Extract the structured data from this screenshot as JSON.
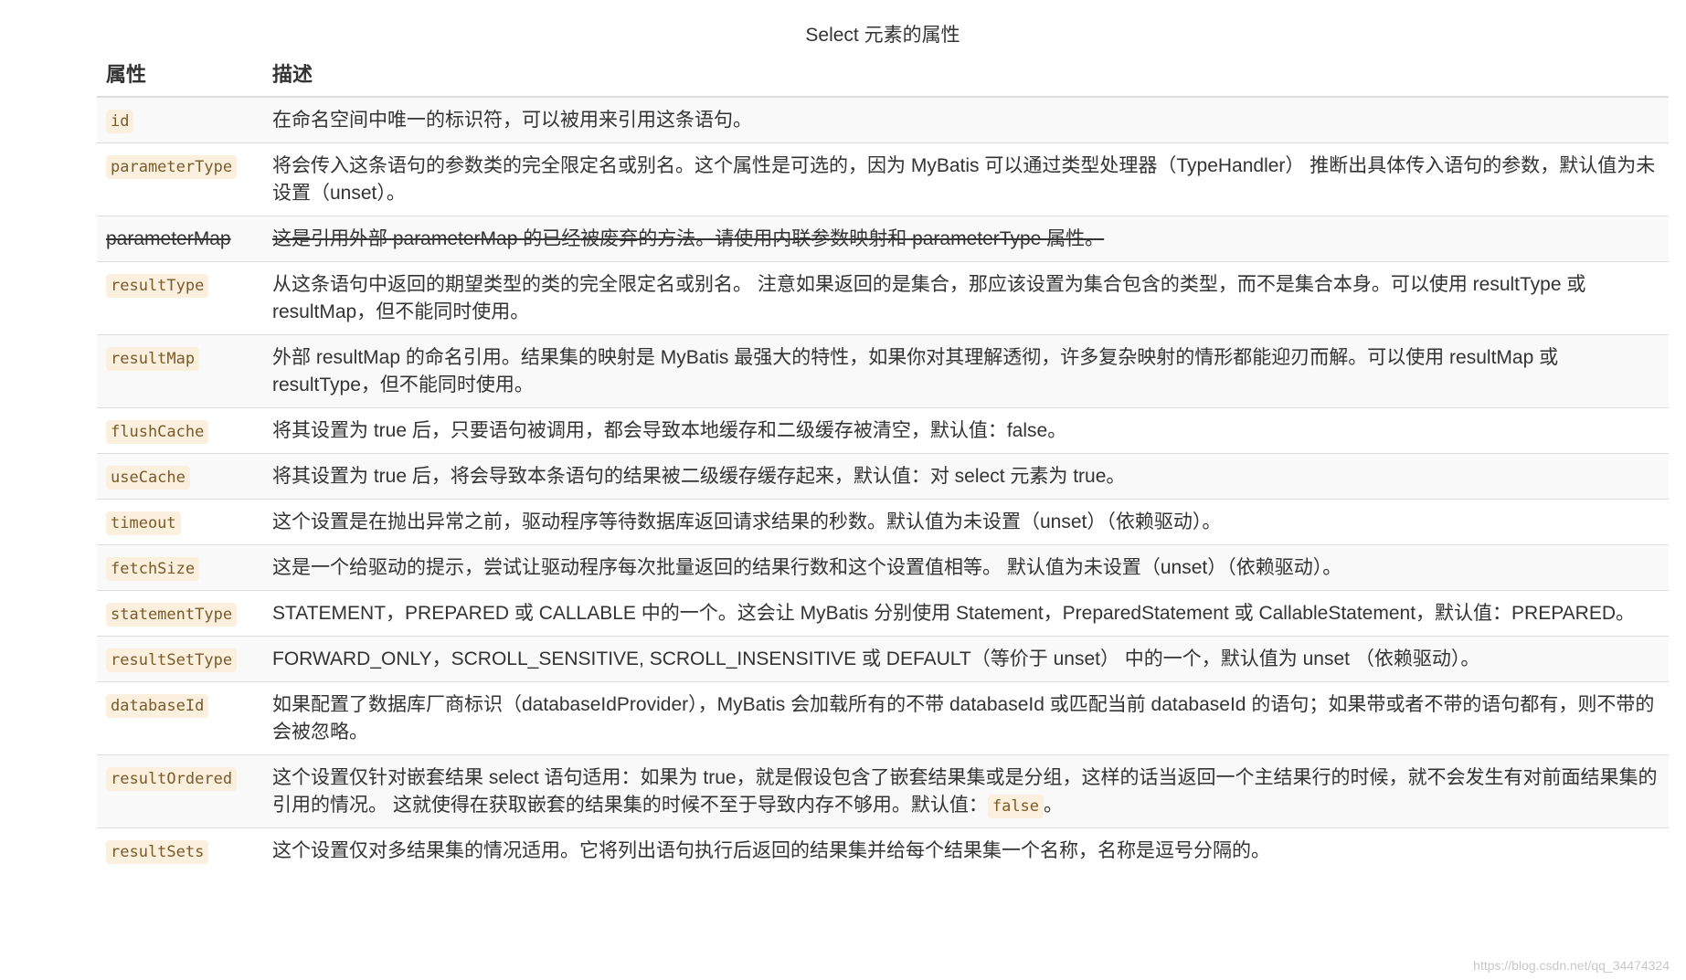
{
  "caption": "Select 元素的属性",
  "table": {
    "headers": {
      "attr": "属性",
      "desc": "描述"
    },
    "rows": [
      {
        "attr": "id",
        "desc": "在命名空间中唯一的标识符，可以被用来引用这条语句。"
      },
      {
        "attr": "parameterType",
        "desc": "将会传入这条语句的参数类的完全限定名或别名。这个属性是可选的，因为 MyBatis 可以通过类型处理器（TypeHandler） 推断出具体传入语句的参数，默认值为未设置（unset）。"
      },
      {
        "attr": "parameterMap",
        "desc": "这是引用外部 parameterMap 的已经被废弃的方法。请使用内联参数映射和 parameterType 属性。",
        "deprecated": true
      },
      {
        "attr": "resultType",
        "desc": "从这条语句中返回的期望类型的类的完全限定名或别名。 注意如果返回的是集合，那应该设置为集合包含的类型，而不是集合本身。可以使用 resultType 或 resultMap，但不能同时使用。"
      },
      {
        "attr": "resultMap",
        "desc": "外部 resultMap 的命名引用。结果集的映射是 MyBatis 最强大的特性，如果你对其理解透彻，许多复杂映射的情形都能迎刃而解。可以使用 resultMap 或 resultType，但不能同时使用。"
      },
      {
        "attr": "flushCache",
        "desc": "将其设置为 true 后，只要语句被调用，都会导致本地缓存和二级缓存被清空，默认值：false。"
      },
      {
        "attr": "useCache",
        "desc": "将其设置为 true 后，将会导致本条语句的结果被二级缓存缓存起来，默认值：对 select 元素为 true。"
      },
      {
        "attr": "timeout",
        "desc": "这个设置是在抛出异常之前，驱动程序等待数据库返回请求结果的秒数。默认值为未设置（unset）（依赖驱动）。"
      },
      {
        "attr": "fetchSize",
        "desc": "这是一个给驱动的提示，尝试让驱动程序每次批量返回的结果行数和这个设置值相等。 默认值为未设置（unset）（依赖驱动）。"
      },
      {
        "attr": "statementType",
        "desc": "STATEMENT，PREPARED 或 CALLABLE 中的一个。这会让 MyBatis 分别使用 Statement，PreparedStatement 或 CallableStatement，默认值：PREPARED。"
      },
      {
        "attr": "resultSetType",
        "desc": "FORWARD_ONLY，SCROLL_SENSITIVE, SCROLL_INSENSITIVE 或 DEFAULT（等价于 unset） 中的一个，默认值为 unset （依赖驱动）。"
      },
      {
        "attr": "databaseId",
        "desc": "如果配置了数据库厂商标识（databaseIdProvider），MyBatis 会加载所有的不带 databaseId 或匹配当前 databaseId 的语句；如果带或者不带的语句都有，则不带的会被忽略。"
      },
      {
        "attr": "resultOrdered",
        "desc": "这个设置仅针对嵌套结果 select 语句适用：如果为 true，就是假设包含了嵌套结果集或是分组，这样的话当返回一个主结果行的时候，就不会发生有对前面结果集的引用的情况。 这就使得在获取嵌套的结果集的时候不至于导致内存不够用。默认值：",
        "desc_code": "false",
        "desc_tail": "。"
      },
      {
        "attr": "resultSets",
        "desc": "这个设置仅对多结果集的情况适用。它将列出语句执行后返回的结果集并给每个结果集一个名称，名称是逗号分隔的。"
      }
    ]
  },
  "watermark": "https://blog.csdn.net/qq_34474324"
}
